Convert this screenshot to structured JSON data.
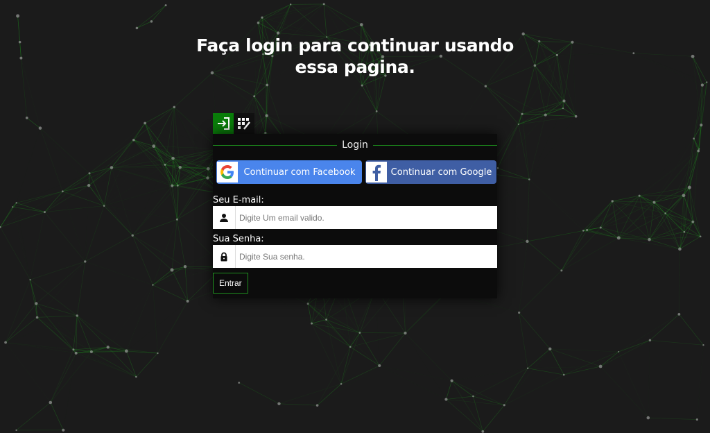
{
  "page": {
    "title": "Faça login para continuar usando essa pagina."
  },
  "tabs": [
    {
      "icon": "login-icon",
      "active": true
    },
    {
      "icon": "register-icon",
      "active": false
    }
  ],
  "form": {
    "legend": "Login",
    "google_label": "Continuar com Facebook",
    "facebook_label": "Continuar com Google",
    "email_label": "Seu E-mail:",
    "email_placeholder": "Digite Um email valido.",
    "email_value": "",
    "password_label": "Sua Senha:",
    "password_placeholder": "Digite Sua senha.",
    "password_value": "",
    "submit_label": "Entrar"
  },
  "colors": {
    "background": "#1b1b1b",
    "accent_green": "#0a7d0a",
    "google_button": "#4a85ec",
    "facebook_button": "#3f5ea4",
    "network_lines": "#1f9a1f"
  }
}
